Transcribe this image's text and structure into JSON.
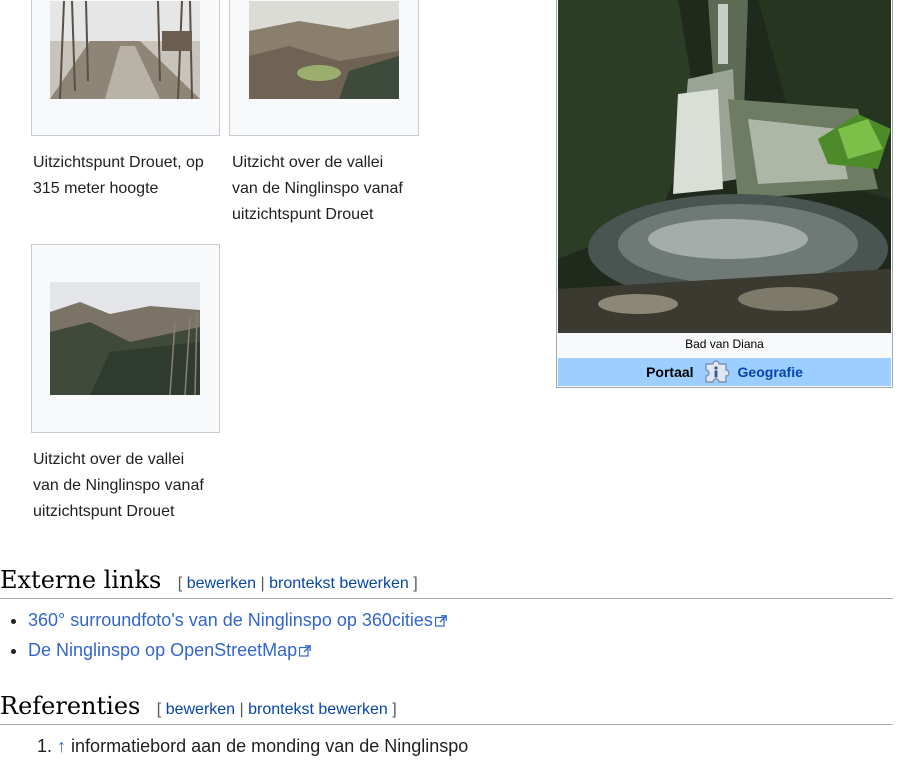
{
  "gallery": [
    {
      "caption_line1": "Uitzichtspunt Drouet, op",
      "caption_line2": "315 meter hoogte",
      "caption_line3": ""
    },
    {
      "caption_line1": "Uitzicht over de vallei",
      "caption_line2": "van de Ninglinspo vanaf",
      "caption_line3": "uitzichtspunt Drouet"
    },
    {
      "caption_line1": "Uitzicht over de vallei",
      "caption_line2": "van de Ninglinspo vanaf",
      "caption_line3": "uitzichtspunt Drouet"
    }
  ],
  "infobox": {
    "caption": "Bad van Diana",
    "portal_label": "Portaal",
    "portal_link": "Geografie"
  },
  "external_links": {
    "heading": "Externe links",
    "edit": "bewerken",
    "edit_source": "brontekst bewerken",
    "bracket_open": "[",
    "separator": "|",
    "bracket_close": "]",
    "items": [
      "360° surroundfoto's van de Ninglinspo op 360cities",
      "De Ninglinspo op OpenStreetMap"
    ]
  },
  "references": {
    "heading": "Referenties",
    "edit": "bewerken",
    "edit_source": "brontekst bewerken",
    "bracket_open": "[",
    "separator": "|",
    "bracket_close": "]",
    "items": [
      {
        "number": "1.",
        "backlink": "↑",
        "text": "informatiebord aan de monding van de Ninglinspo"
      }
    ]
  },
  "colors": {
    "link": "#3366cc",
    "portal_bar": "#9ccfff",
    "border": "#a2a9b1"
  }
}
